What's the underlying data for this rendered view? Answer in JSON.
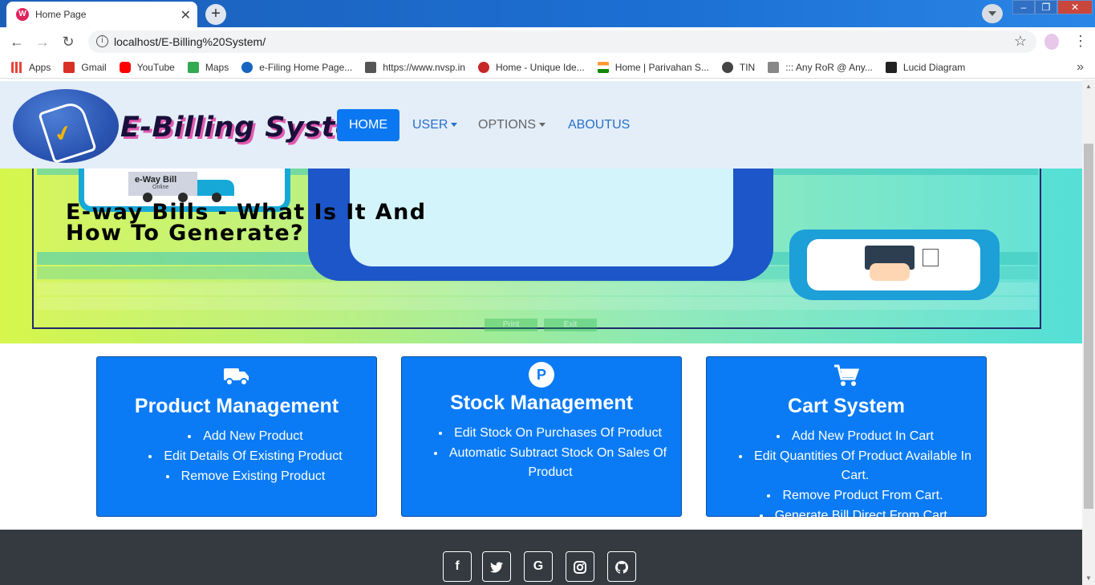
{
  "browser": {
    "tab_title": "Home Page",
    "tab_close": "✕",
    "new_tab": "+",
    "url": "localhost/E-Billing%20System/",
    "bookmarks": [
      {
        "label": "Apps",
        "color": "#e8453c"
      },
      {
        "label": "Gmail",
        "color": "#d93025"
      },
      {
        "label": "YouTube",
        "color": "#ff0000"
      },
      {
        "label": "Maps",
        "color": "#34a853"
      },
      {
        "label": "e-Filing Home Page...",
        "color": "#1565c0"
      },
      {
        "label": "https://www.nvsp.in",
        "color": "#555555"
      },
      {
        "label": "Home - Unique Ide...",
        "color": "#c62828"
      },
      {
        "label": "Home | Parivahan S...",
        "color": "#ff9933"
      },
      {
        "label": "TIN",
        "color": "#444444"
      },
      {
        "label": "::: Any RoR @ Any...",
        "color": "#666666"
      },
      {
        "label": "Lucid Diagram",
        "color": "#222222"
      }
    ]
  },
  "navbar": {
    "brand": "E-Billing System",
    "home": "HOME",
    "user": "USER",
    "options": "OPTIONS",
    "about": "ABOUTUS"
  },
  "banner": {
    "headline": "E-way Bills - What Is It And How To Generate?",
    "truck_label": "e-Way Bill",
    "truck_sublabel": "Online",
    "sheet_buttons": [
      "Print",
      "Exit"
    ]
  },
  "features": [
    {
      "icon": "truck-icon",
      "title": "Product Management",
      "items": [
        "Add New Product",
        "Edit Details Of Existing Product",
        "Remove Existing Product"
      ]
    },
    {
      "icon": "parking-icon",
      "title": "Stock Management",
      "items": [
        "Edit Stock On Purchases Of Product",
        "Automatic Subtract Stock On Sales Of Product"
      ]
    },
    {
      "icon": "cart-icon",
      "title": "Cart System",
      "items": [
        "Add New Product In Cart",
        "Edit Quantities Of Product Available In Cart.",
        "Remove Product From Cart.",
        "Generate Bill Direct From Cart."
      ]
    }
  ],
  "footer": {
    "social": [
      "f",
      "t",
      "G",
      "ig",
      "gh"
    ]
  },
  "colors": {
    "accent": "#0a7bf5",
    "footer_bg": "#343a40",
    "navbar_bg": "#e3eef9"
  }
}
